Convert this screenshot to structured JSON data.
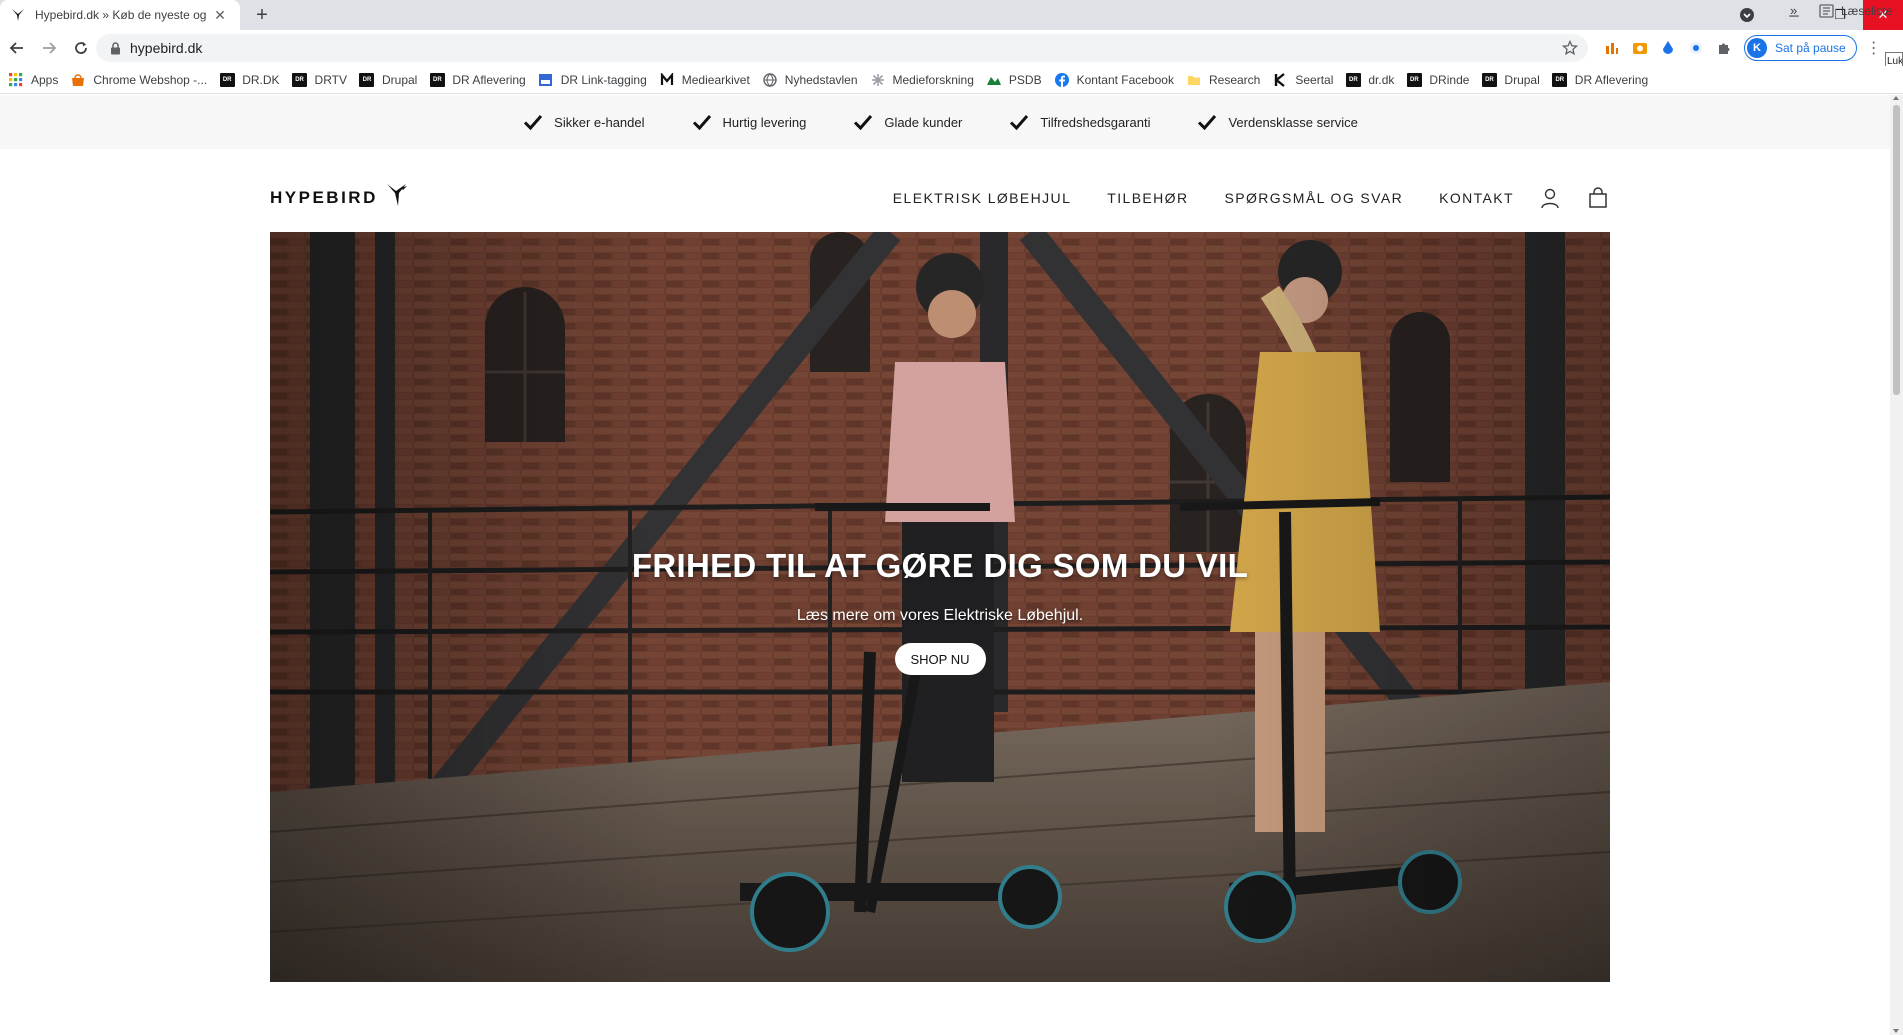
{
  "browser": {
    "tab": {
      "title": "Hypebird.dk » Køb de nyeste og",
      "close_glyph": "✕"
    },
    "new_tab_glyph": "+",
    "window_controls": {
      "minimize": "─",
      "restore": "❐",
      "close": "✕"
    },
    "address": {
      "url": "hypebird.dk"
    },
    "profile": {
      "initial": "K",
      "label": "Sat på pause"
    },
    "menu_glyph": "⋮",
    "tooltip": "Luk",
    "bookmarks": [
      {
        "label": "Apps",
        "icon": "apps-grid-icon"
      },
      {
        "label": "Chrome Webshop -...",
        "icon": "webstore-icon"
      },
      {
        "label": "DR.DK",
        "icon": "dr-icon"
      },
      {
        "label": "DRTV",
        "icon": "dr-icon"
      },
      {
        "label": "Drupal",
        "icon": "dr-icon"
      },
      {
        "label": "DR Aflevering",
        "icon": "dr-icon"
      },
      {
        "label": "DR Link-tagging",
        "icon": "link-tagging-icon"
      },
      {
        "label": "Mediearkivet",
        "icon": "m-icon"
      },
      {
        "label": "Nyhedstavlen",
        "icon": "globe-icon"
      },
      {
        "label": "Medieforskning",
        "icon": "sparkle-icon"
      },
      {
        "label": "PSDB",
        "icon": "psdb-icon"
      },
      {
        "label": "Kontant Facebook",
        "icon": "facebook-icon"
      },
      {
        "label": "Research",
        "icon": "folder-icon"
      },
      {
        "label": "Seertal",
        "icon": "k-icon"
      },
      {
        "label": "dr.dk",
        "icon": "dr-icon"
      },
      {
        "label": "DRinde",
        "icon": "dr-icon"
      },
      {
        "label": "Drupal",
        "icon": "dr-icon"
      },
      {
        "label": "DR Aflevering",
        "icon": "dr-icon"
      }
    ],
    "bookmarks_overflow": "»",
    "reading_list": "Læseliste"
  },
  "usp_bar": {
    "items": [
      "Sikker e-handel",
      "Hurtig levering",
      "Glade kunder",
      "Tilfredshedsgaranti",
      "Verdensklasse service"
    ]
  },
  "header": {
    "logo_text": "HYPEBIRD",
    "nav": [
      "ELEKTRISK LØBEHJUL",
      "TILBEHØR",
      "SPØRGSMÅL OG SVAR",
      "KONTAKT"
    ]
  },
  "hero": {
    "title": "FRIHED TIL AT GØRE DIG SOM DU VIL",
    "subtitle": "Læs mere om vores Elektriske Løbehjul.",
    "cta": "SHOP NU"
  },
  "colors": {
    "brick": "#7a4636",
    "close_red": "#e81123",
    "profile_blue": "#1a73e8",
    "usp_bg": "#f7f7f7"
  }
}
